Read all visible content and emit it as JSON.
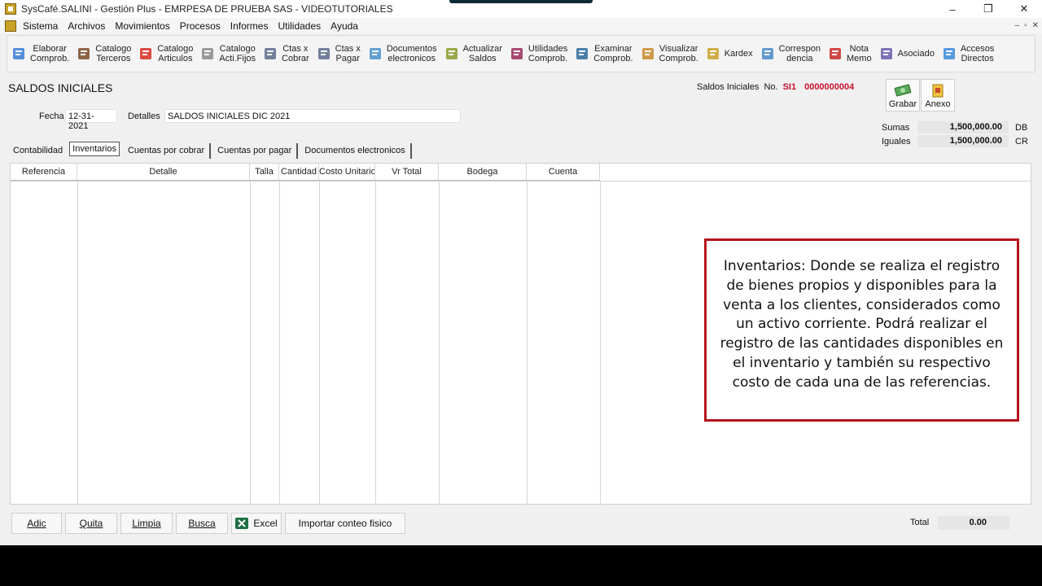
{
  "window": {
    "title": "SysCafé.SALINI - Gestión Plus - EMRPESA DE PRUEBA SAS - VIDEOTUTORIALES",
    "controls": [
      "–",
      "❐",
      "✕"
    ]
  },
  "menu": {
    "items": [
      "Sistema",
      "Archivos",
      "Movimientos",
      "Procesos",
      "Informes",
      "Utilidades",
      "Ayuda"
    ],
    "mdi_controls": [
      "–",
      "▫",
      "✕"
    ]
  },
  "toolbar": {
    "buttons": [
      {
        "label": "Elaborar\nComprob.",
        "icon": "document-edit-icon",
        "color": "#3a7bd5"
      },
      {
        "label": "Catalogo\nTerceros",
        "icon": "person-icon",
        "color": "#7a4b2a"
      },
      {
        "label": "Catalogo\nArticulos",
        "icon": "red-cube-icon",
        "color": "#d62d20"
      },
      {
        "label": "Catalogo\nActi.Fijos",
        "icon": "printer-icon",
        "color": "#888888"
      },
      {
        "label": "Ctas x\nCobrar",
        "icon": "receivable-icon",
        "color": "#5a6b8c"
      },
      {
        "label": "Ctas x\nPagar",
        "icon": "payable-icon",
        "color": "#5a6b8c"
      },
      {
        "label": "Documentos\nelectronicos",
        "icon": "electronic-docs-icon",
        "color": "#4a90c8"
      },
      {
        "label": "Actualizar\nSaldos",
        "icon": "refresh-gears-icon",
        "color": "#8a9a2a"
      },
      {
        "label": "Utilidades\nComprob.",
        "icon": "tools-icon",
        "color": "#9a2a5a"
      },
      {
        "label": "Examinar\nComprob.",
        "icon": "examine-icon",
        "color": "#2a6a9a"
      },
      {
        "label": "Visualizar\nComprob.",
        "icon": "magnifier-icon",
        "color": "#c88a2a"
      },
      {
        "label": "Kardex",
        "icon": "kardex-icon",
        "color": "#c8a02a"
      },
      {
        "label": "Correspon\ndencia",
        "icon": "mail-icon",
        "color": "#4a8ac8"
      },
      {
        "label": "Nota\nMemo",
        "icon": "note-icon",
        "color": "#c82a2a"
      },
      {
        "label": "Asociado",
        "icon": "associates-icon",
        "color": "#6a5aa8"
      },
      {
        "label": "Accesos\nDirectos",
        "icon": "folder-icon",
        "color": "#3a8ad8"
      }
    ]
  },
  "form": {
    "title": "SALDOS INICIALES",
    "doc_type_label": "Saldos Iniciales",
    "doc_no_label": "No.",
    "doc_prefix": "SI1",
    "doc_number": "0000000004",
    "fecha_label": "Fecha",
    "fecha_value": "12-31-2021",
    "detalles_label": "Detalles",
    "detalles_value": "SALDOS INICIALES DIC 2021",
    "grabar_label": "Grabar",
    "anexo_label": "Anexo",
    "sumas_label": "Sumas",
    "sumas_value": "1,500,000.00",
    "sumas_side": "DB",
    "iguales_label": "Iguales",
    "iguales_value": "1,500,000.00",
    "iguales_side": "CR"
  },
  "tabs": [
    "Contabilidad",
    "Inventarios",
    "Cuentas por cobrar",
    "Cuentas por pagar",
    "Documentos electronicos"
  ],
  "active_tab": "Inventarios",
  "grid": {
    "columns": [
      "Referencia",
      "Detalle",
      "Talla",
      "Cantidad",
      "Costo Unitario",
      "Vr Total",
      "Bodega",
      "Cuenta"
    ],
    "rows": []
  },
  "callout": {
    "text": "Inventarios: Donde se realiza el registro de bienes propios y disponibles para la venta a los clientes, considerados como un activo corriente. Podrá realizar el registro de las cantidades disponibles en el inventario y también su respectivo costo de cada una de las referencias."
  },
  "bottom": {
    "buttons": [
      "Adic",
      "Quita",
      "Limpia",
      "Busca",
      "Excel",
      "Importar conteo fisico"
    ],
    "total_label": "Total",
    "total_value": "0.00"
  }
}
